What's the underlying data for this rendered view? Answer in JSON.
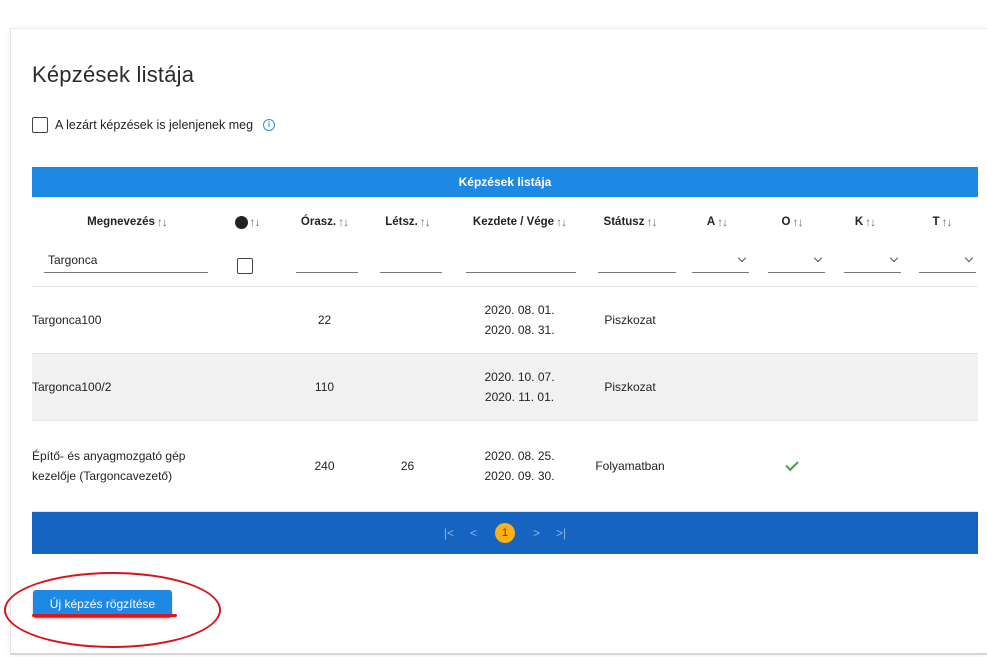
{
  "page": {
    "title": "Képzések listája"
  },
  "filters": {
    "show_closed_label": "A lezárt képzések is jelenjenek meg",
    "info_icon": "ⓘ"
  },
  "table": {
    "caption": "Képzések listája",
    "sort_icon": "↑↓",
    "columns": {
      "name": "Megnevezés",
      "web": "🌍",
      "hours": "Órasz.",
      "count": "Létsz.",
      "dates": "Kezdete / Vége",
      "status": "Státusz",
      "a": "A",
      "o": "O",
      "k": "K",
      "t": "T"
    },
    "filter_values": {
      "name": "Targonca"
    },
    "rows": [
      {
        "name": "Targonca100",
        "hours": "22",
        "count": "",
        "start": "2020. 08. 01.",
        "end": "2020. 08. 31.",
        "status": "Piszkozat",
        "o_checked": false
      },
      {
        "name": "Targonca100/2",
        "hours": "110",
        "count": "",
        "start": "2020. 10. 07.",
        "end": "2020. 11. 01.",
        "status": "Piszkozat",
        "o_checked": false
      },
      {
        "name": "Építő- és anyagmozgató gép kezelője (Targoncavezető)",
        "hours": "240",
        "count": "26",
        "start": "2020. 08. 25.",
        "end": "2020. 09. 30.",
        "status": "Folyamatban",
        "o_checked": true
      }
    ]
  },
  "pager": {
    "first": "|<",
    "prev": "<",
    "current": "1",
    "next": ">",
    "last": ">|"
  },
  "actions": {
    "new_label": "Új képzés rögzítése"
  },
  "colors": {
    "primary": "#1e88e5",
    "pager": "#1565c0",
    "current_page": "#f9b116",
    "annotation": "#d7141a",
    "check": "#43a047"
  }
}
